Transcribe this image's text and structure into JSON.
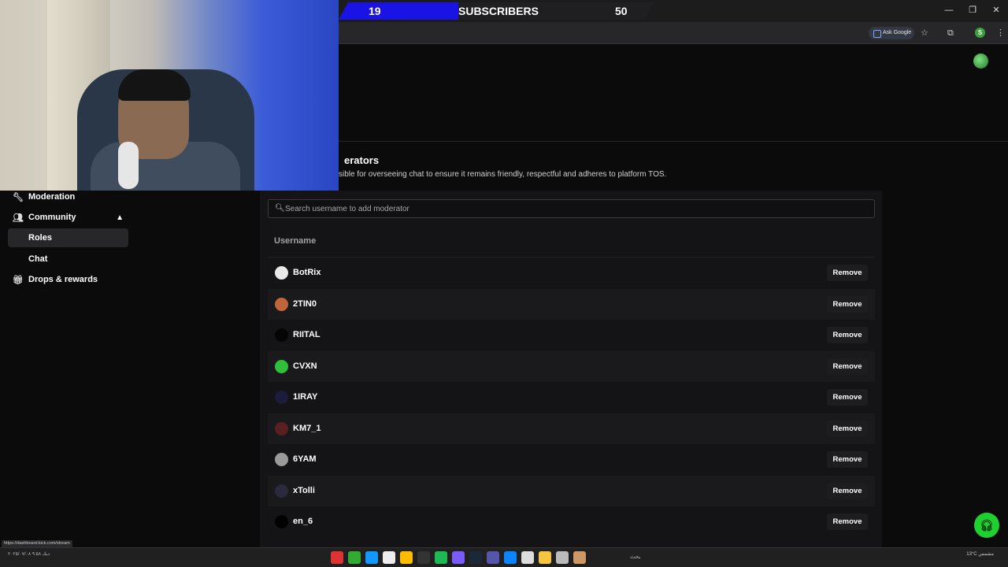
{
  "overlay": {
    "subscribers_current": "19",
    "subscribers_label": "SUBSCRIBERS",
    "subscribers_goal": "50",
    "progress_fraction": 0.38
  },
  "browser": {
    "ask_google_label": "Ask Google",
    "profile_initial": "S",
    "window_controls": [
      "—",
      "❐",
      "✕"
    ]
  },
  "section": {
    "title": "erators",
    "description": "sible for overseeing chat to ensure it remains friendly, respectful and adheres to platform TOS."
  },
  "sidebar": {
    "items": [
      {
        "label": "Moderation",
        "icon": "wrench-icon"
      },
      {
        "label": "Community",
        "icon": "people-icon",
        "expanded": true
      },
      {
        "label": "Roles",
        "active": true
      },
      {
        "label": "Chat"
      },
      {
        "label": "Drops & rewards",
        "icon": "gift-icon"
      }
    ]
  },
  "search": {
    "placeholder": "Search username to add moderator"
  },
  "table": {
    "column_header": "Username",
    "remove_label": "Remove",
    "rows": [
      {
        "username": "BotRix",
        "avatar_color": "#e8e8e8"
      },
      {
        "username": "2TIN0",
        "avatar_color": "#c0653a"
      },
      {
        "username": "RIITAL",
        "avatar_color": "#050505"
      },
      {
        "username": "CVXN",
        "avatar_color": "#2fbf3a"
      },
      {
        "username": "1IRAY",
        "avatar_color": "#1b1b3a"
      },
      {
        "username": "KM7_1",
        "avatar_color": "#5a2020"
      },
      {
        "username": "6YAM",
        "avatar_color": "#9a9a9a"
      },
      {
        "username": "xTolli",
        "avatar_color": "#2a2a3a"
      },
      {
        "username": "en_6",
        "avatar_color": "#020202"
      }
    ]
  },
  "status_url": "https://dashboard.kick.com/stream",
  "taskbar": {
    "left_text": "ديك ٩:٥٨ ٢٠٢٥/٠٧/٠٨",
    "search_text": "بحث",
    "right_text": "13°C مشمس"
  },
  "colors": {
    "accent_green": "#1fd12f",
    "banner_blue": "#1a13e6",
    "panel_bg": "#141416"
  }
}
